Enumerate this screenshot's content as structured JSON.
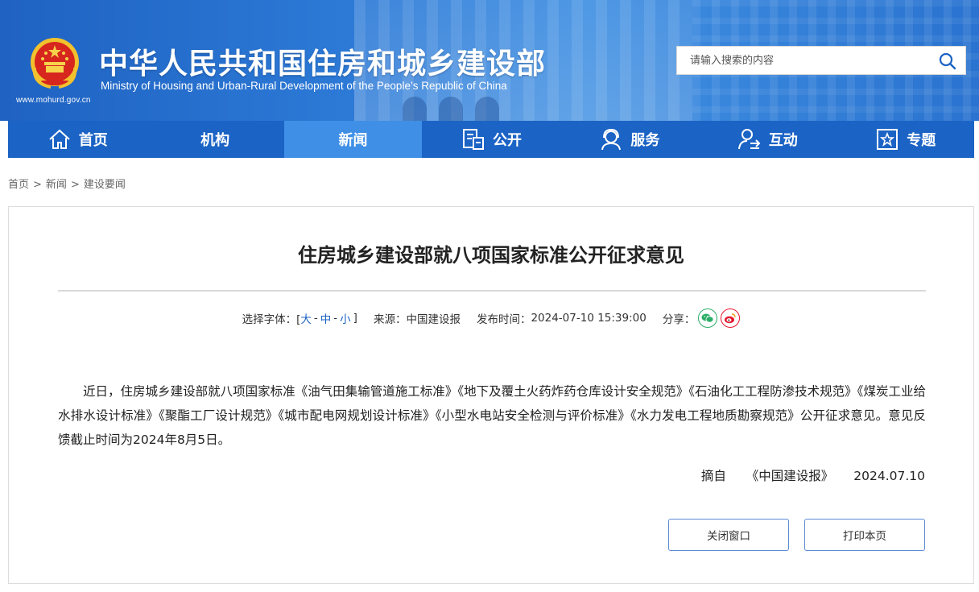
{
  "header": {
    "site_title": "中华人民共和国住房和城乡建设部",
    "site_subtitle": "Ministry of Housing and Urban-Rural Development of the People’s Republic of China",
    "site_url": "www.mohurd.gov.cn",
    "search_placeholder": "请输入搜索的内容"
  },
  "nav": {
    "items": [
      {
        "label": "首页",
        "icon": "home-icon"
      },
      {
        "label": "机构",
        "icon": ""
      },
      {
        "label": "新闻",
        "icon": "",
        "active": true
      },
      {
        "label": "公开",
        "icon": "document-icon"
      },
      {
        "label": "服务",
        "icon": "service-icon"
      },
      {
        "label": "互动",
        "icon": "interaction-icon"
      },
      {
        "label": "专题",
        "icon": "star-icon"
      }
    ]
  },
  "breadcrumb": [
    "首页",
    "新闻",
    "建设要闻"
  ],
  "article": {
    "title": "住房城乡建设部就八项国家标准公开征求意见",
    "font_size_label": "选择字体：[",
    "font_size_options": [
      "大",
      "中",
      "小"
    ],
    "font_size_close": "]",
    "source_label": "来源：",
    "source": "中国建设报",
    "published_label": "发布时间：",
    "published": "2024-07-10 15:39:00",
    "share_label": "分享：",
    "body": "近日，住房城乡建设部就八项国家标准《油气田集输管道施工标准》《地下及覆土火药炸药仓库设计安全规范》《石油化工工程防渗技术规范》《煤炭工业给水排水设计标准》《聚酯工厂设计规范》《城市配电网规划设计标准》《小型水电站安全检测与评价标准》《水力发电工程地质勘察规范》公开征求意见。意见反馈截止时间为2024年8月5日。",
    "excerpt_label": "摘自",
    "excerpt_source": "《中国建设报》",
    "excerpt_date": "2024.07.10"
  },
  "buttons": {
    "close": "关闭窗口",
    "print": "打印本页"
  },
  "colors": {
    "nav_bg": "#1b63c5",
    "nav_active": "#3f8fe6",
    "wechat": "#2aae67",
    "weibo": "#e6162d"
  }
}
